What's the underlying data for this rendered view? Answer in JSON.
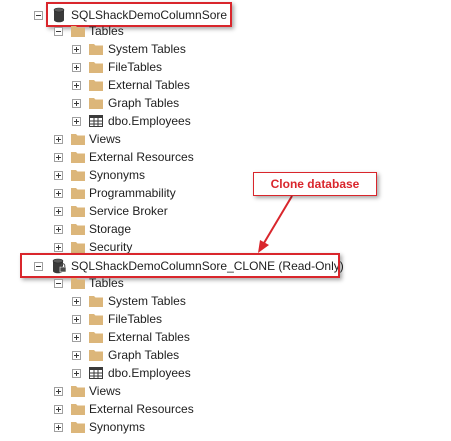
{
  "tree": {
    "db1": {
      "label": "SQLShackDemoColumnSore",
      "icon": "database-icon"
    },
    "db1_children": [
      {
        "label": "Tables",
        "icon": "folder-icon",
        "expanded": true
      },
      {
        "label": "System Tables",
        "icon": "folder-icon"
      },
      {
        "label": "FileTables",
        "icon": "folder-icon"
      },
      {
        "label": "External Tables",
        "icon": "folder-icon"
      },
      {
        "label": "Graph Tables",
        "icon": "folder-icon"
      },
      {
        "label": "dbo.Employees",
        "icon": "table-icon"
      },
      {
        "label": "Views",
        "icon": "folder-icon"
      },
      {
        "label": "External Resources",
        "icon": "folder-icon"
      },
      {
        "label": "Synonyms",
        "icon": "folder-icon"
      },
      {
        "label": "Programmability",
        "icon": "folder-icon"
      },
      {
        "label": "Service Broker",
        "icon": "folder-icon"
      },
      {
        "label": "Storage",
        "icon": "folder-icon"
      },
      {
        "label": "Security",
        "icon": "folder-icon"
      }
    ],
    "db2": {
      "label": "SQLShackDemoColumnSore_CLONE (Read-Only)",
      "icon": "database-readonly-icon"
    },
    "db2_children": [
      {
        "label": "Tables",
        "icon": "folder-icon",
        "expanded": true
      },
      {
        "label": "System Tables",
        "icon": "folder-icon"
      },
      {
        "label": "FileTables",
        "icon": "folder-icon"
      },
      {
        "label": "External Tables",
        "icon": "folder-icon"
      },
      {
        "label": "Graph Tables",
        "icon": "folder-icon"
      },
      {
        "label": "dbo.Employees",
        "icon": "table-icon"
      },
      {
        "label": "Views",
        "icon": "folder-icon"
      },
      {
        "label": "External Resources",
        "icon": "folder-icon"
      },
      {
        "label": "Synonyms",
        "icon": "folder-icon"
      }
    ]
  },
  "annotation": {
    "label": "Clone database"
  },
  "colors": {
    "highlight": "#d9262c",
    "folder": "#dcb67a"
  }
}
